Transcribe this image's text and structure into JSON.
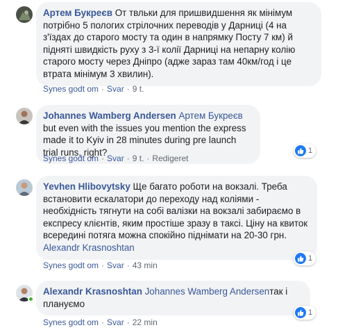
{
  "comments": [
    {
      "author": "Артем Букреєв",
      "text": "От твльки для пришвидшення як мінімум потрібно 5 пологих стрілочних переводів у Дарниці (4 на з'їздах до старого мосту та один в напрямку Посту 7 км) й підняті швидкість руху з 3-ї колії Дарниці на непарну колію старого мосту через Дніпро (адже зараз там 40км/год і це втрата мінімум 3 хвилин).",
      "like_label": "Synes godt om",
      "reply_label": "Svar",
      "time": "9 t."
    },
    {
      "author": "Johannes Wamberg Andersen",
      "mention": "Артем Букреєв",
      "text": "but even with the issues you mention the express made it to Kyiv in 28 minutes during pre launch trial runs, right?",
      "like_label": "Synes godt om",
      "reply_label": "Svar",
      "time": "9 t.",
      "edited": "Redigeret",
      "reaction_count": "1"
    },
    {
      "author": "Yevhen Hlibovytsky",
      "text": "Ще багато роботи на вокзалі. Треба встановити ескалатори до переходу над коліями - необхідність тягнути на собі валізки на вокзалі забираємо в експресу клієнтів, яким простіше зразу в таксі. Ціну на квиток всередині потяга можна спокійно піднімати на 20-30 грн.",
      "mention": "Alexandr Krasnoshtan",
      "like_label": "Synes godt om",
      "reply_label": "Svar",
      "time": "43 min",
      "reaction_count": "1"
    },
    {
      "author": "Alexandr Krasnoshtan",
      "mention": "Johannes Wamberg Andersen",
      "text": "так і плануємо",
      "like_label": "Synes godt om",
      "reply_label": "Svar",
      "time": "22 min",
      "reaction_count": "1"
    }
  ],
  "colors": {
    "link": "#385898",
    "bubble": "#f2f3f5",
    "meta": "#606770",
    "like": "#2078f4",
    "online": "#42b72a"
  },
  "icons": {
    "like": "thumbs-up-icon"
  }
}
